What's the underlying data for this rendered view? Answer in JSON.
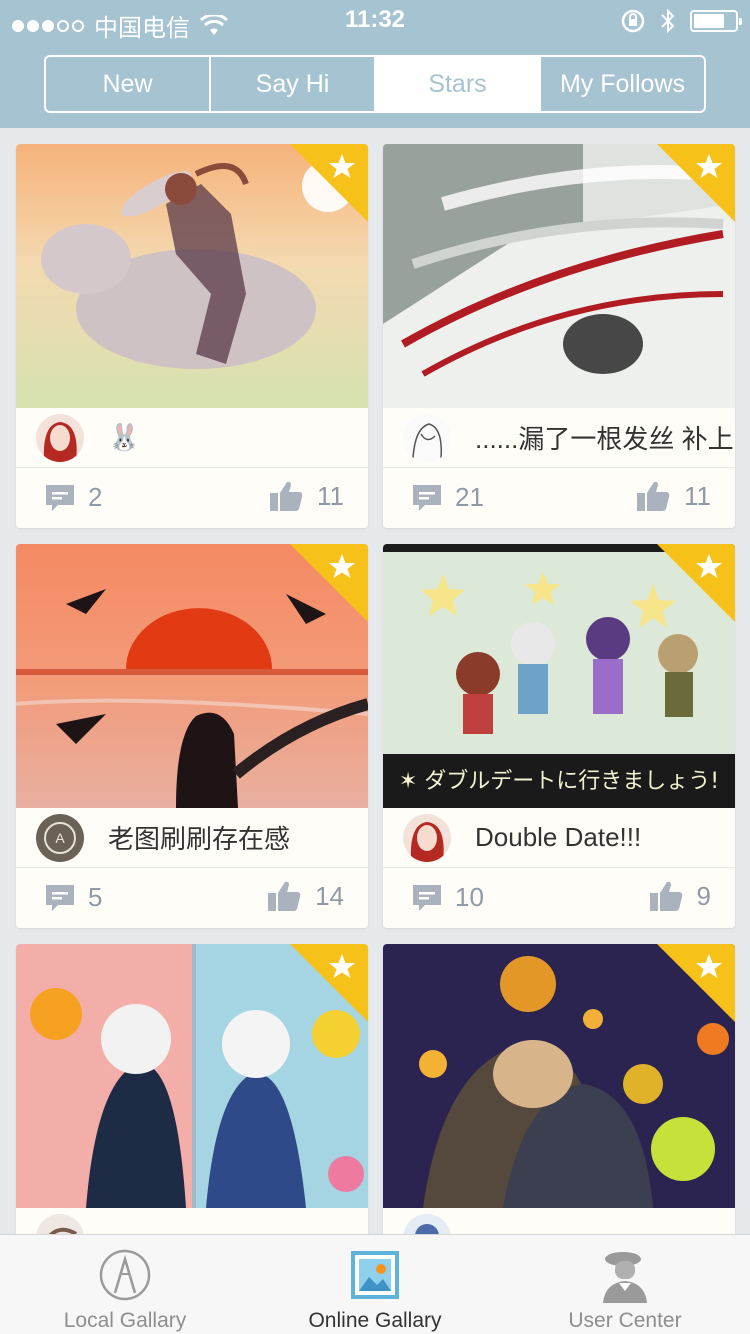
{
  "status_bar": {
    "carrier": "中国电信",
    "time": "11:32"
  },
  "tabs": [
    {
      "label": "New",
      "active": false
    },
    {
      "label": "Say Hi",
      "active": false
    },
    {
      "label": "Stars",
      "active": true
    },
    {
      "label": "My Follows",
      "active": false
    }
  ],
  "cards": [
    {
      "title": "🐰",
      "comments": "2",
      "likes": "11",
      "starred": true
    },
    {
      "title": "......漏了一根发丝 补上",
      "comments": "21",
      "likes": "11",
      "starred": true
    },
    {
      "title": "老图刷刷存在感",
      "comments": "5",
      "likes": "14",
      "starred": true
    },
    {
      "title": "Double Date!!!",
      "comments": "10",
      "likes": "9",
      "starred": true
    },
    {
      "title": "",
      "comments": "",
      "likes": "",
      "starred": true
    },
    {
      "title": "",
      "comments": "",
      "likes": "",
      "starred": true
    }
  ],
  "tabbar": [
    {
      "label": "Local Gallary",
      "icon": "pencil-circle-icon",
      "active": false
    },
    {
      "label": "Online Gallary",
      "icon": "framed-picture-icon",
      "active": true
    },
    {
      "label": "User Center",
      "icon": "artist-beret-icon",
      "active": false
    }
  ],
  "colors": {
    "header": "#a6c3d2",
    "accent_star": "#f6c21a",
    "muted": "#8f9aa6"
  }
}
